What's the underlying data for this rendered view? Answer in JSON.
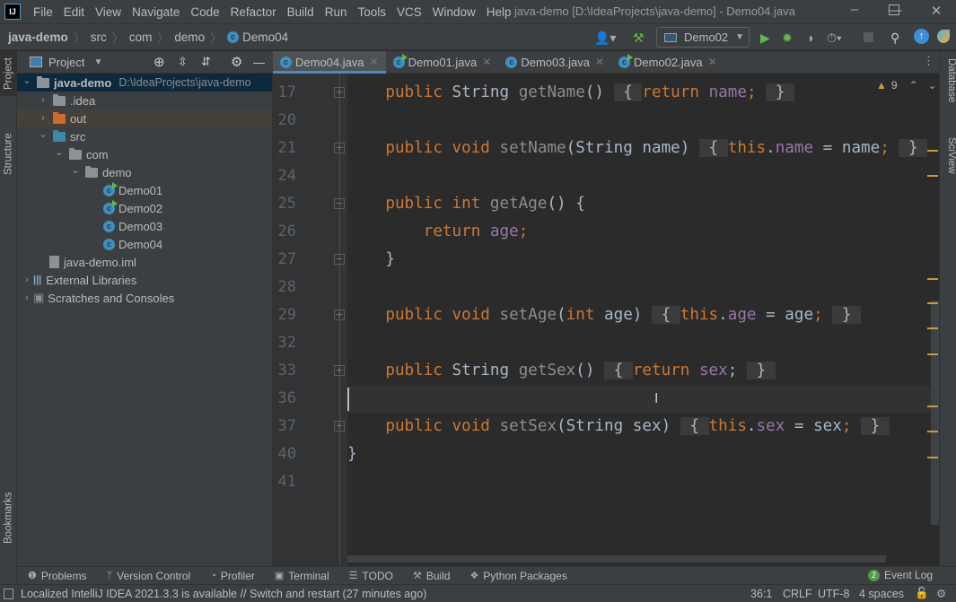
{
  "app": {
    "logo": "IJ",
    "window_title": "java-demo [D:\\IdeaProjects\\java-demo] - Demo04.java"
  },
  "menu": [
    "File",
    "Edit",
    "View",
    "Navigate",
    "Code",
    "Refactor",
    "Build",
    "Run",
    "Tools",
    "VCS",
    "Window",
    "Help"
  ],
  "breadcrumb": [
    "java-demo",
    "src",
    "com",
    "demo",
    "Demo04"
  ],
  "toolbar": {
    "run_config": "Demo02"
  },
  "left_stripe": {
    "project": "Project",
    "structure": "Structure",
    "bookmarks": "Bookmarks"
  },
  "right_stripe": {
    "database": "Database",
    "sciview": "SciView"
  },
  "project_panel": {
    "title": "Project",
    "tree": [
      {
        "label": "java-demo",
        "hint": "D:\\IdeaProjects\\java-demo",
        "type": "module",
        "expanded": true
      },
      {
        "label": ".idea",
        "type": "folder",
        "expanded": false
      },
      {
        "label": "out",
        "type": "folder-excluded",
        "expanded": false
      },
      {
        "label": "src",
        "type": "folder-source",
        "expanded": true
      },
      {
        "label": "com",
        "type": "package",
        "expanded": true
      },
      {
        "label": "demo",
        "type": "package",
        "expanded": true
      },
      {
        "label": "Demo01",
        "type": "class-runnable"
      },
      {
        "label": "Demo02",
        "type": "class-runnable"
      },
      {
        "label": "Demo03",
        "type": "class"
      },
      {
        "label": "Demo04",
        "type": "class"
      },
      {
        "label": "java-demo.iml",
        "type": "file"
      },
      {
        "label": "External Libraries",
        "type": "libraries",
        "expanded": false
      },
      {
        "label": "Scratches and Consoles",
        "type": "scratches",
        "expanded": false
      }
    ]
  },
  "tabs": [
    {
      "label": "Demo04.java",
      "active": true,
      "runnable": false
    },
    {
      "label": "Demo01.java",
      "runnable": true
    },
    {
      "label": "Demo03.java",
      "runnable": false
    },
    {
      "label": "Demo02.java",
      "runnable": true
    }
  ],
  "editor": {
    "warnings": "9",
    "caret_line": "36",
    "lines": [
      {
        "n": "17",
        "fold": "plus",
        "tokens": [
          [
            "    ",
            ""
          ],
          [
            "public ",
            "kw"
          ],
          [
            "String ",
            ""
          ],
          [
            "getName",
            "fn"
          ],
          [
            "() ",
            ""
          ],
          [
            " { ",
            "fold"
          ],
          [
            "return ",
            "kwf"
          ],
          [
            "name",
            "fdf"
          ],
          [
            "; ",
            "kwf"
          ],
          [
            " } ",
            "fold"
          ]
        ]
      },
      {
        "n": "20",
        "tokens": []
      },
      {
        "n": "21",
        "fold": "plus",
        "tokens": [
          [
            "    ",
            ""
          ],
          [
            "public ",
            "kw"
          ],
          [
            "void ",
            "kw"
          ],
          [
            "setName",
            "fn"
          ],
          [
            "(String name) ",
            ""
          ],
          [
            " { ",
            "fold"
          ],
          [
            "this",
            "kw"
          ],
          [
            ".",
            ""
          ],
          [
            "name",
            "fd"
          ],
          [
            " = name",
            ""
          ],
          [
            "; ",
            "kwf"
          ],
          [
            " } ",
            "fold"
          ]
        ]
      },
      {
        "n": "24",
        "tokens": []
      },
      {
        "n": "25",
        "fold": "minus",
        "tokens": [
          [
            "    ",
            ""
          ],
          [
            "public ",
            "kw"
          ],
          [
            "int ",
            "kw"
          ],
          [
            "getAge",
            "fn"
          ],
          [
            "() {",
            ""
          ]
        ]
      },
      {
        "n": "26",
        "tokens": [
          [
            "        ",
            ""
          ],
          [
            "return ",
            "kw"
          ],
          [
            "age",
            "fd"
          ],
          [
            ";",
            "kw"
          ]
        ]
      },
      {
        "n": "27",
        "fold": "end",
        "tokens": [
          [
            "    }",
            ""
          ]
        ]
      },
      {
        "n": "28",
        "tokens": []
      },
      {
        "n": "29",
        "fold": "plus",
        "tokens": [
          [
            "    ",
            ""
          ],
          [
            "public ",
            "kw"
          ],
          [
            "void ",
            "kw"
          ],
          [
            "setAge",
            "fn"
          ],
          [
            "(",
            ""
          ],
          [
            "int ",
            "kw"
          ],
          [
            "age) ",
            ""
          ],
          [
            " { ",
            "fold"
          ],
          [
            "this",
            "kw"
          ],
          [
            ".",
            ""
          ],
          [
            "age",
            "fd"
          ],
          [
            " = age",
            ""
          ],
          [
            "; ",
            "kwf"
          ],
          [
            " } ",
            "fold"
          ]
        ]
      },
      {
        "n": "32",
        "tokens": []
      },
      {
        "n": "33",
        "fold": "plus",
        "tokens": [
          [
            "    ",
            ""
          ],
          [
            "public ",
            "kw"
          ],
          [
            "String ",
            ""
          ],
          [
            "getSex",
            "fn"
          ],
          [
            "() ",
            ""
          ],
          [
            " { ",
            "fold"
          ],
          [
            "return ",
            "kw"
          ],
          [
            "sex",
            "fd"
          ],
          [
            "; ",
            ""
          ],
          [
            " } ",
            "fold"
          ]
        ]
      },
      {
        "n": "36",
        "tokens": []
      },
      {
        "n": "37",
        "fold": "plus",
        "tokens": [
          [
            "    ",
            ""
          ],
          [
            "public ",
            "kw"
          ],
          [
            "void ",
            "kw"
          ],
          [
            "setSex",
            "fn"
          ],
          [
            "(String sex) ",
            ""
          ],
          [
            " { ",
            "fold"
          ],
          [
            "this",
            "kw"
          ],
          [
            ".",
            ""
          ],
          [
            "sex",
            "fd"
          ],
          [
            " = sex",
            ""
          ],
          [
            "; ",
            "kwf"
          ],
          [
            " } ",
            "fold"
          ]
        ]
      },
      {
        "n": "40",
        "tokens": [
          [
            "}",
            ""
          ]
        ]
      },
      {
        "n": "41",
        "tokens": []
      }
    ]
  },
  "tool_windows": [
    "Problems",
    "Version Control",
    "Profiler",
    "Terminal",
    "TODO",
    "Build",
    "Python Packages"
  ],
  "event_log": {
    "label": "Event Log",
    "count": "2"
  },
  "status": {
    "message": "Localized IntelliJ IDEA 2021.3.3 is available // Switch and restart (27 minutes ago)",
    "position": "36:1",
    "line_sep": "CRLF",
    "encoding": "UTF-8",
    "indent": "4 spaces"
  },
  "colors": {
    "keyword": "#cc7832",
    "field": "#9876aa",
    "text": "#a9b7c6",
    "accent": "#4a88c7",
    "warning": "#c79b3a"
  }
}
